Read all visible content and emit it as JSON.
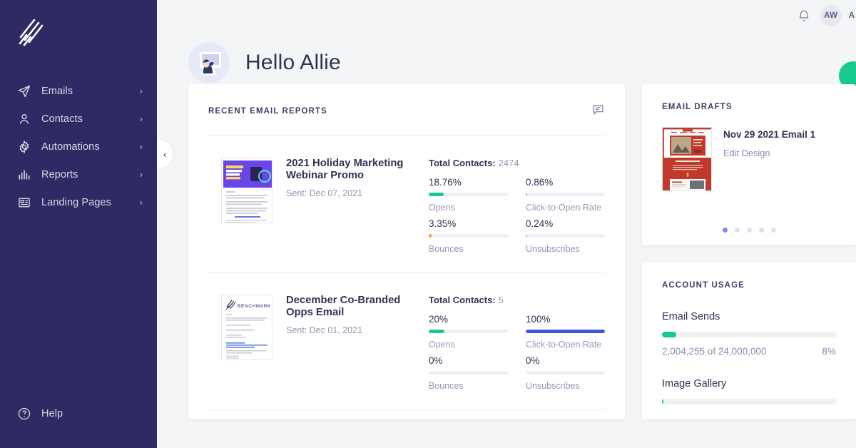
{
  "sidebar": {
    "logo_name": "benchmark-logo",
    "items": [
      {
        "label": "Emails",
        "icon": "paper-plane-icon",
        "chevron": "›"
      },
      {
        "label": "Contacts",
        "icon": "person-icon",
        "chevron": "›"
      },
      {
        "label": "Automations",
        "icon": "gear-icon",
        "chevron": "›"
      },
      {
        "label": "Reports",
        "icon": "bar-chart-icon",
        "chevron": "›"
      },
      {
        "label": "Landing Pages",
        "icon": "landing-page-icon",
        "chevron": "›"
      }
    ],
    "help": {
      "label": "Help",
      "icon": "question-circle-icon"
    },
    "collapse_chevron": "‹",
    "bg_color": "#2e2a63"
  },
  "topbar": {
    "bell_icon": "notification-bell-icon",
    "avatar_initials": "AW",
    "avatar_next_initial": "A"
  },
  "greeting": {
    "text": "Hello Allie"
  },
  "reports": {
    "title": "Recent Email Reports",
    "chat_icon": "chat-bubble-icon",
    "rows": [
      {
        "name": "2021 Holiday Marketing Webinar Promo",
        "sent": "Sent: Dec 07, 2021",
        "total_label": "Total Contacts:",
        "total_value": "2474",
        "stats": [
          {
            "value": "18.76%",
            "label": "Opens",
            "pct": 18.76,
            "color": "#16c98d"
          },
          {
            "value": "0.86%",
            "label": "Click-to-Open Rate",
            "pct": 0.86,
            "color": "#3f55e0"
          },
          {
            "value": "3.35%",
            "label": "Bounces",
            "pct": 3.35,
            "color": "#f5a623"
          },
          {
            "value": "0.24%",
            "label": "Unsubscribes",
            "pct": 0.24,
            "color": "#e8445a"
          }
        ]
      },
      {
        "name": "December Co-Branded Opps Email",
        "sent": "Sent: Dec 01, 2021",
        "total_label": "Total Contacts:",
        "total_value": "5",
        "stats": [
          {
            "value": "20%",
            "label": "Opens",
            "pct": 20,
            "color": "#16c98d"
          },
          {
            "value": "100%",
            "label": "Click-to-Open Rate",
            "pct": 100,
            "color": "#3f55e0"
          },
          {
            "value": "0%",
            "label": "Bounces",
            "pct": 0,
            "color": "#f5a623"
          },
          {
            "value": "0%",
            "label": "Unsubscribes",
            "pct": 0,
            "color": "#e8445a"
          }
        ]
      }
    ]
  },
  "drafts": {
    "title": "Email Drafts",
    "item": {
      "name": "Nov 29 2021 Email 1",
      "action": "Edit Design"
    },
    "dots": 5,
    "active_dot": 0
  },
  "usage": {
    "title": "Account Usage",
    "blocks": [
      {
        "name": "Email Sends",
        "text": "2,004,255 of 24,000,000",
        "pct_label": "8%",
        "pct": 8
      },
      {
        "name": "Image Gallery",
        "text": "",
        "pct_label": "",
        "pct": 1
      }
    ]
  },
  "accent": {
    "green": "#16c98d",
    "navy": "#2e2a63",
    "blue": "#3f55e0"
  }
}
